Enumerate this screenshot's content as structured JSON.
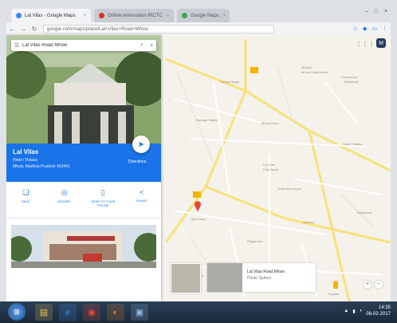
{
  "browser": {
    "tabs": [
      {
        "label": "Lal Vilas - Google Maps",
        "active": true,
        "color": "#4285f4"
      },
      {
        "label": "Online reservation IRCTC",
        "active": false,
        "color": "#d93025"
      },
      {
        "label": "Google Maps",
        "active": false,
        "color": "#34a853"
      }
    ],
    "window_controls": [
      "–",
      "□",
      "×"
    ],
    "url": "google.com/maps/place/Lal+Vilas+Road+Mhow",
    "icons": [
      "back-icon",
      "forward-icon",
      "reload-icon",
      "star-icon",
      "extension-icon",
      "cast-icon",
      "menu-icon"
    ]
  },
  "search": {
    "query": "Lal Vilas Road Mhow",
    "placeholder": "Search Google Maps"
  },
  "place": {
    "name": "Lal Vilas",
    "category": "Hotel / Palace",
    "address": "Mhow, Madhya Pradesh 453441",
    "directions_label": "Directions",
    "actions": [
      {
        "label": "SAVE",
        "icon": "bookmark-icon"
      },
      {
        "label": "NEARBY",
        "icon": "nearby-icon"
      },
      {
        "label": "SEND TO YOUR PHONE",
        "icon": "phone-icon"
      },
      {
        "label": "SHARE",
        "icon": "share-icon"
      }
    ]
  },
  "map": {
    "labels": [
      "Manpur",
      "Mhow Cantonment",
      "Kishanganj",
      "Bhatkhedi",
      "Sanjay Nagar",
      "Railway Station",
      "Mhow Gaon",
      "Lal Vilas",
      "Patti Bazar",
      "Gawli Palasia",
      "Ambedkar Nagar",
      "Bus Stand",
      "Harsola",
      "Badgonda",
      "Pigdamber"
    ],
    "controls": {
      "apps": "⋮⋮⋮",
      "avatar": "M",
      "zoom_in": "+",
      "zoom_out": "−",
      "explore": "Explore"
    }
  },
  "streetview": {
    "title": "Lal Vilas Road Mhow",
    "subtitle": "Photo Sphere"
  },
  "taskbar": {
    "apps": [
      {
        "name": "explorer-icon",
        "color": "#e8c45a"
      },
      {
        "name": "ie-icon",
        "color": "#3a8de0"
      },
      {
        "name": "chrome-icon",
        "color": "#e54a3b"
      },
      {
        "name": "firefox-icon",
        "color": "#e8812b"
      },
      {
        "name": "media-icon",
        "color": "#8fb7dc"
      }
    ],
    "time": "14:35",
    "date": "06-02-2017"
  }
}
